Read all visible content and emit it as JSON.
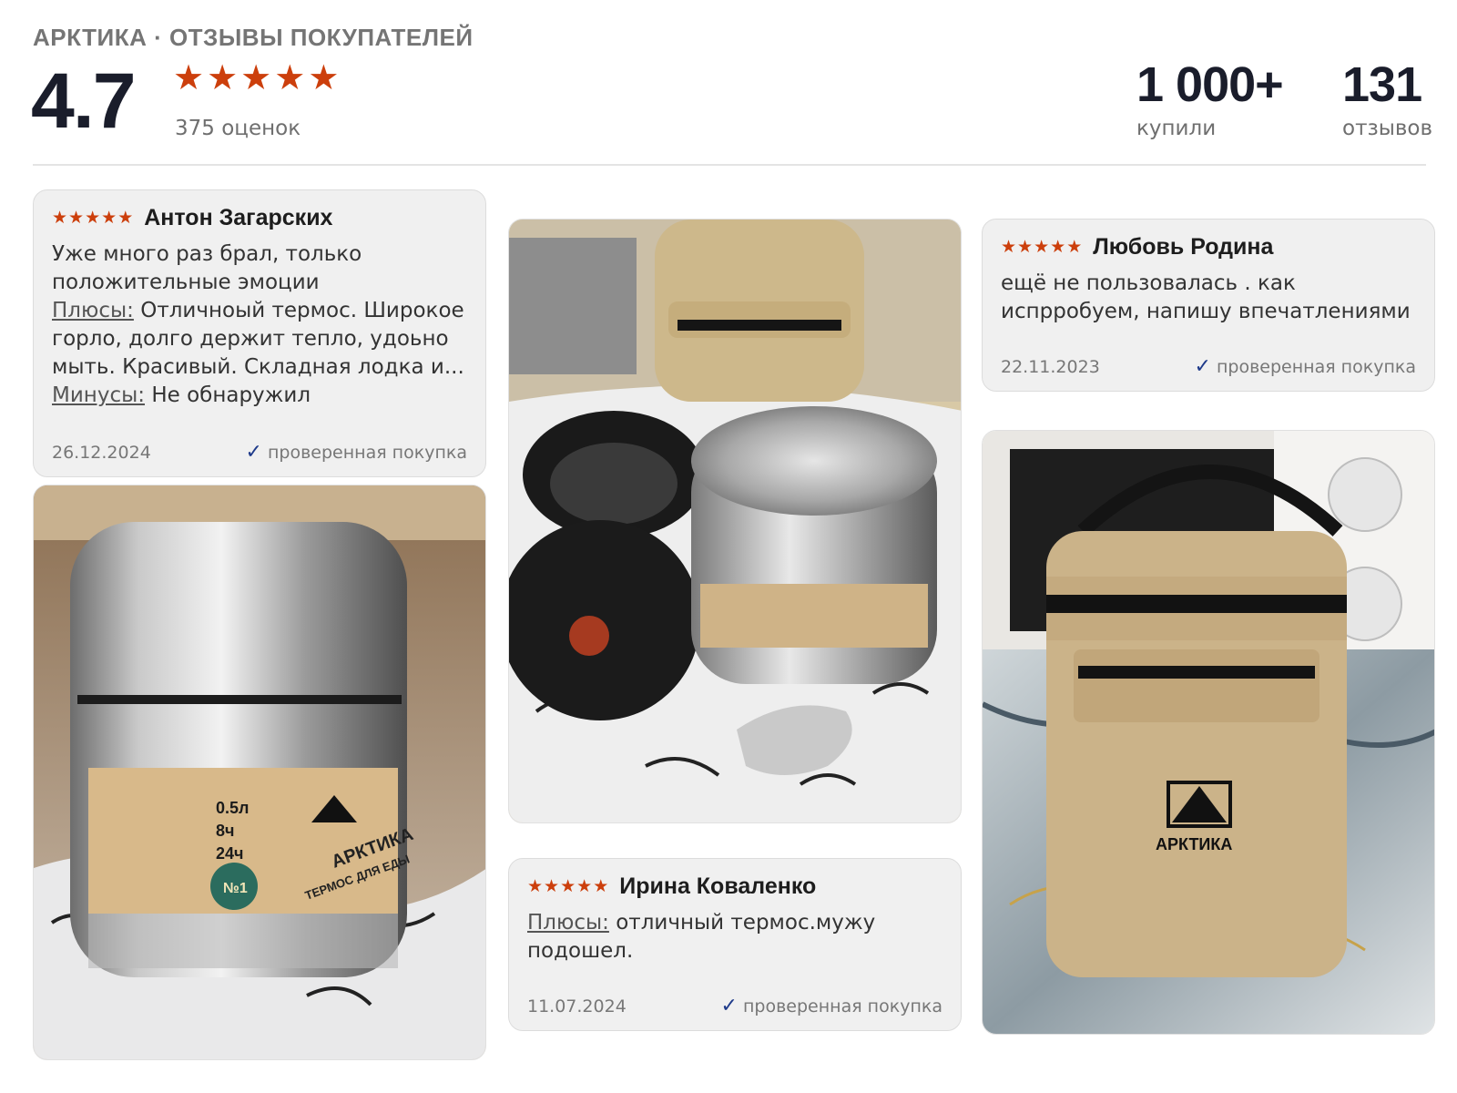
{
  "header": {
    "brand_line": "АРКТИКА · ОТЗЫВЫ ПОКУПАТЕЛЕЙ",
    "rating": "4.7",
    "rating_stars": 5,
    "ratings_count": "375 оценок",
    "stats": {
      "bought_value": "1 000+",
      "bought_label": "купили",
      "reviews_value": "131",
      "reviews_label": "отзывов"
    }
  },
  "reviews": [
    {
      "stars": 5,
      "author": "Антон Загарских",
      "text": "Уже много раз брал, только положительные эмоции",
      "pros_label": "Плюсы:",
      "pros": "Отличноый термос. Широкое горло, долго держит тепло, удоьно мыть. Красивый. Складная лодка и...",
      "cons_label": "Минусы:",
      "cons": "Не обнаружил",
      "date": "26.12.2024",
      "verified": "проверенная покупка"
    },
    {
      "stars": 5,
      "author": "Ирина Коваленко",
      "pros_label": "Плюсы:",
      "pros": "отличный термос.мужу подошел.",
      "date": "11.07.2024",
      "verified": "проверенная покупка"
    },
    {
      "stars": 5,
      "author": "Любовь Родина",
      "text": "ещё не пользовалась . как испрробуем, напишу впечатлениями",
      "date": "22.11.2023",
      "verified": "проверенная покупка"
    }
  ],
  "colors": {
    "star": "#cc3f0c",
    "verified_check": "#1e3a8a",
    "card_bg": "#f0f0f0"
  },
  "icons": {
    "star": "star-icon",
    "verified": "check-icon"
  },
  "photo_labels": {
    "photo1": {
      "brand": "АРКТИКА",
      "subtitle": "ТЕРМОС ДЛЯ ЕДЫ",
      "spec1": "0.5л",
      "spec2": "8ч",
      "spec3": "24ч",
      "badge": "№1"
    },
    "photo3": {
      "brand": "АРКТИКА"
    }
  }
}
